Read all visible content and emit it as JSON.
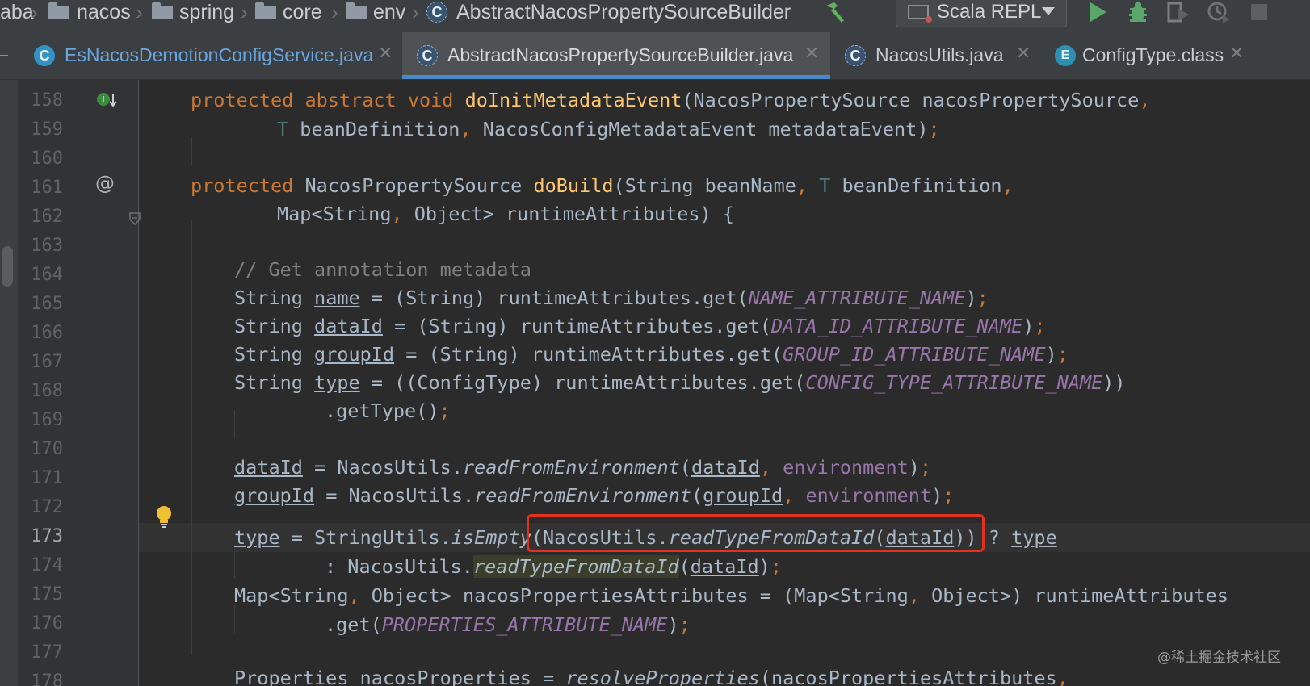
{
  "navbar": {
    "breadcrumbs": [
      "aba",
      "nacos",
      "spring",
      "core",
      "env",
      "AbstractNacosPropertySourceBuilder"
    ],
    "run_config": "Scala REPL",
    "icons": [
      "build-hammer-icon",
      "run-icon",
      "debug-icon",
      "coverage-icon",
      "profile-icon",
      "stop-icon"
    ]
  },
  "tabs": [
    {
      "label": "EsNacosDemotionConfigService.java",
      "icon": "class-icon",
      "active": false
    },
    {
      "label": "AbstractNacosPropertySourceBuilder.java",
      "icon": "abstract-class-icon",
      "active": true
    },
    {
      "label": "NacosUtils.java",
      "icon": "abstract-class-icon",
      "active": false
    },
    {
      "label": "ConfigType.class",
      "icon": "enum-icon",
      "active": false
    }
  ],
  "editor": {
    "current_line": "173",
    "lines": [
      {
        "n": "158"
      },
      {
        "n": "159"
      },
      {
        "n": "160"
      },
      {
        "n": "161"
      },
      {
        "n": "162"
      },
      {
        "n": "163"
      },
      {
        "n": "164"
      },
      {
        "n": "165"
      },
      {
        "n": "166"
      },
      {
        "n": "167"
      },
      {
        "n": "168"
      },
      {
        "n": "169"
      },
      {
        "n": "170"
      },
      {
        "n": "171"
      },
      {
        "n": "172"
      },
      {
        "n": "173"
      },
      {
        "n": "174"
      },
      {
        "n": "175"
      },
      {
        "n": "176"
      },
      {
        "n": "177"
      },
      {
        "n": "178"
      }
    ],
    "code": {
      "l158": {
        "a": "protected abstract void ",
        "b": "doInitMetadataEvent",
        "c": "(NacosPropertySource nacosPropertySource",
        "d": ","
      },
      "l159": {
        "a": "T",
        "b": " beanDefinition",
        "c": ",",
        "d": " NacosConfigMetadataEvent metadataEvent)",
        "e": ";"
      },
      "l161": {
        "a": "protected ",
        "b": "NacosPropertySource ",
        "c": "doBuild",
        "d": "(String beanName",
        "e": ",",
        "f": "T",
        "g": " beanDefinition",
        "h": ","
      },
      "l162": {
        "a": "Map<String",
        "b": ",",
        "c": " Object> runtimeAttributes) {"
      },
      "l164": {
        "a": "// Get annotation metadata"
      },
      "l165": {
        "a": "String ",
        "b": "name",
        "c": " = (String) runtimeAttributes.get(",
        "d": "NAME_ATTRIBUTE_NAME",
        "e": ")",
        "f": ";"
      },
      "l166": {
        "a": "String ",
        "b": "dataId",
        "c": " = (String) runtimeAttributes.get(",
        "d": "DATA_ID_ATTRIBUTE_NAME",
        "e": ")",
        "f": ";"
      },
      "l167": {
        "a": "String ",
        "b": "groupId",
        "c": " = (String) runtimeAttributes.get(",
        "d": "GROUP_ID_ATTRIBUTE_NAME",
        "e": ")",
        "f": ";"
      },
      "l168": {
        "a": "String ",
        "b": "type",
        "c": " = ((ConfigType) runtimeAttributes.get(",
        "d": "CONFIG_TYPE_ATTRIBUTE_NAME",
        "e": "))"
      },
      "l169": {
        "a": ".getType()",
        "b": ";"
      },
      "l171": {
        "a": "dataId",
        "b": " = NacosUtils.",
        "c": "readFromEnvironment",
        "d": "(",
        "e": "dataId",
        "f": ",",
        "g": " environment",
        "h": ")",
        "i": ";"
      },
      "l172": {
        "a": "groupId",
        "b": " = NacosUtils.",
        "c": "readFromEnvironment",
        "d": "(",
        "e": "groupId",
        "f": ",",
        "g": " environment",
        "h": ")",
        "i": ";"
      },
      "l173": {
        "a": "type",
        "b": " = StringUtils.",
        "c": "isEmpty",
        "d": "(NacosUtils.",
        "e": "readTypeFromDataId",
        "f": "(",
        "g": "dataId",
        "h": ")) ? ",
        "i": "type"
      },
      "l174": {
        "a": ": NacosUtils.",
        "b": "readTypeFromDataId",
        "c": "(",
        "d": "dataId",
        "e": ")",
        "f": ";"
      },
      "l175": {
        "a": "Map<String",
        "b": ",",
        "c": " Object> nacosPropertiesAttributes = (Map<String",
        "d": ",",
        "e": " Object>) runtimeAttributes"
      },
      "l176": {
        "a": ".get(",
        "b": "PROPERTIES_ATTRIBUTE_NAME",
        "c": ")",
        "d": ";"
      },
      "l178": {
        "a": "Properties nacosProperties = ",
        "b": "resolveProperties",
        "c": "(nacosPropertiesAttributes",
        "d": ","
      }
    }
  },
  "watermark": "@稀土掘金技术社区"
}
